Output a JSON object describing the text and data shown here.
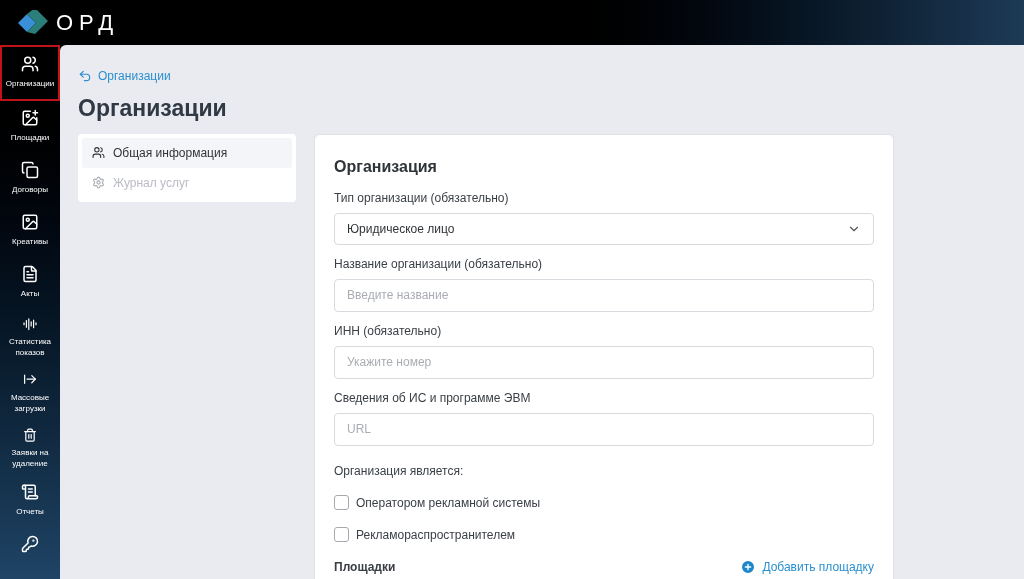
{
  "logo": {
    "text": "ОРД"
  },
  "sidebar": {
    "items": [
      {
        "kind": "users",
        "label": "Организации",
        "selected": true
      },
      {
        "kind": "image-plus",
        "label": "Площадки",
        "selected": false
      },
      {
        "kind": "copy",
        "label": "Договоры",
        "selected": false
      },
      {
        "kind": "image",
        "label": "Креативы",
        "selected": false
      },
      {
        "kind": "file",
        "label": "Акты",
        "selected": false
      },
      {
        "kind": "stats",
        "label": "Статистика показов",
        "selected": false
      },
      {
        "kind": "upload",
        "label": "Массовые загрузки",
        "selected": false
      },
      {
        "kind": "trash",
        "label": "Заявки на удаление",
        "selected": false
      },
      {
        "kind": "report",
        "label": "Отчеты",
        "selected": false
      },
      {
        "kind": "key",
        "selected": false
      }
    ]
  },
  "breadcrumb": "Организации",
  "page_title": "Организации",
  "sections": [
    {
      "kind": "users",
      "label": "Общая информация",
      "selected": true,
      "disabled": false
    },
    {
      "kind": "gear",
      "label": "Журнал услуг",
      "selected": false,
      "disabled": true
    }
  ],
  "form": {
    "title": "Организация",
    "fields": [
      {
        "kind": "select",
        "label": "Тип организации (обязательно)",
        "value": "Юридическое лицо"
      },
      {
        "kind": "input",
        "label": "Название организации (обязательно)",
        "placeholder": "Введите название"
      },
      {
        "kind": "input",
        "label": "ИНН (обязательно)",
        "placeholder": "Укажите номер"
      },
      {
        "kind": "input",
        "label": "Сведения об ИС и программе ЭВМ",
        "placeholder": "URL"
      }
    ],
    "role_label": "Организация является:",
    "checkboxes": [
      {
        "label": "Оператором рекламной системы",
        "checked": false
      },
      {
        "label": "Рекламораспространителем",
        "checked": false
      }
    ],
    "platforms_label": "Площадки",
    "add_button": "Добавить площадку"
  }
}
